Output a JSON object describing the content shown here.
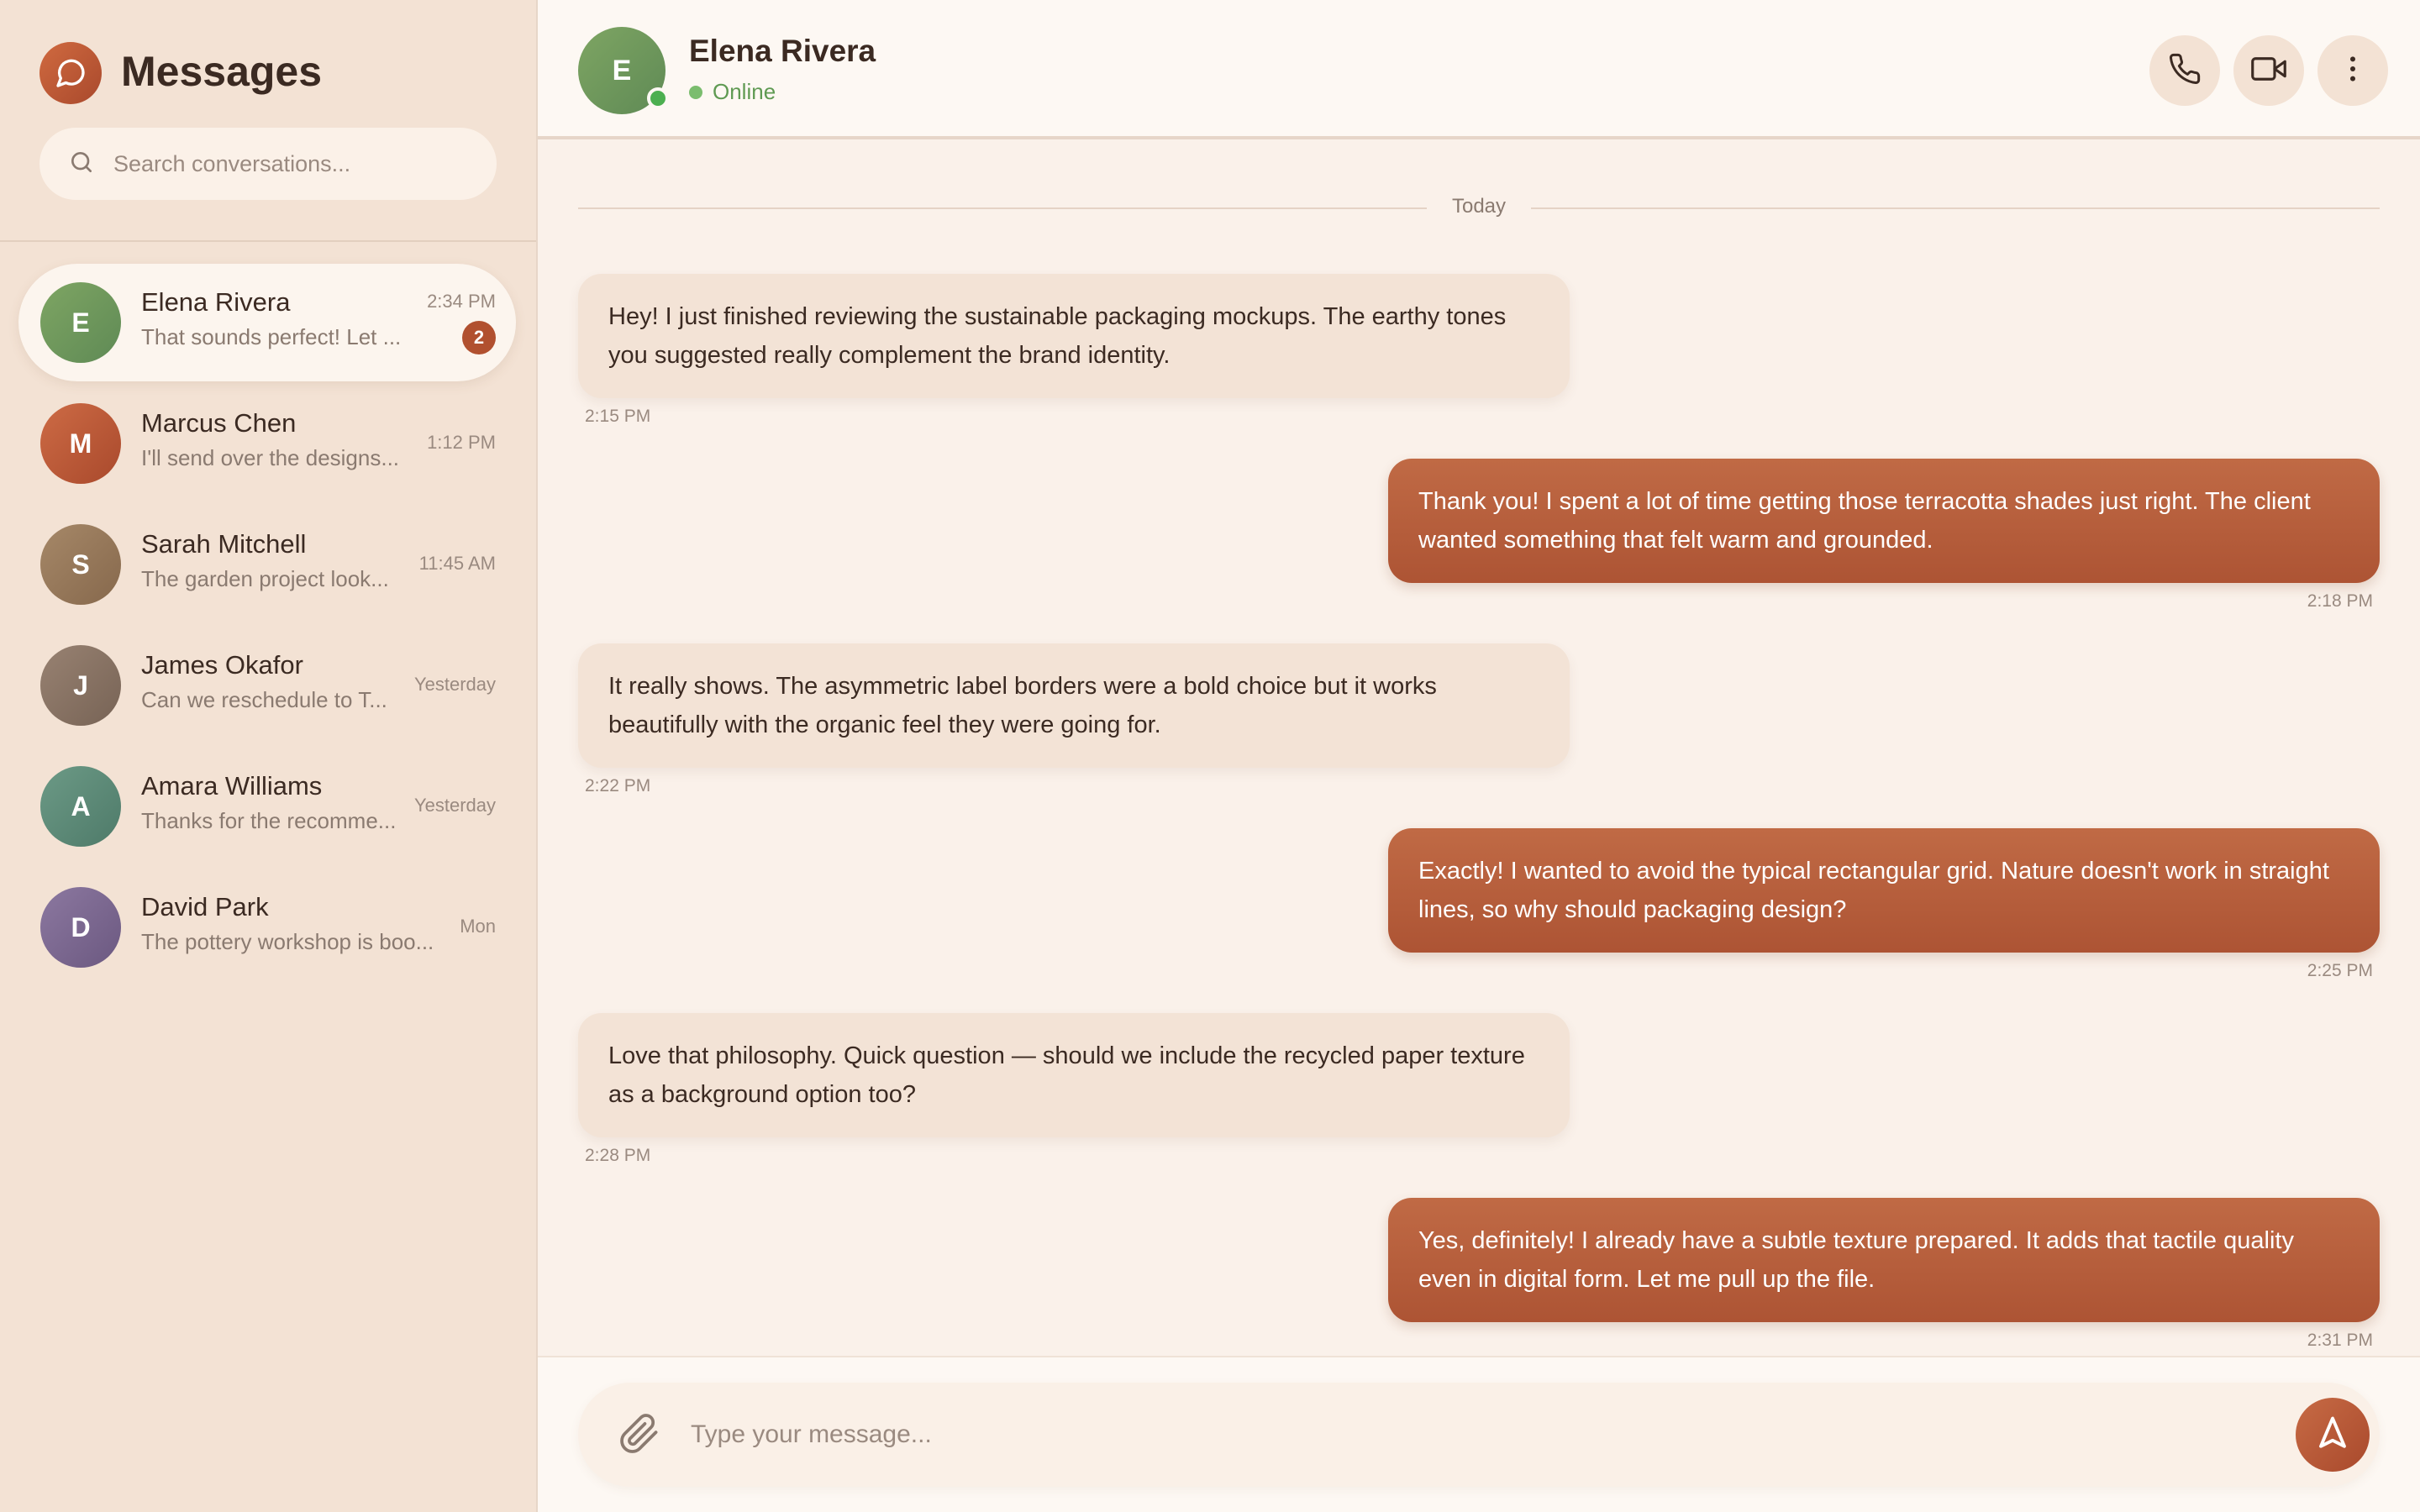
{
  "sidebar": {
    "title": "Messages",
    "search_placeholder": "Search conversations...",
    "conversations": [
      {
        "initial": "E",
        "name": "Elena Rivera",
        "preview": "That sounds perfect! Let ...",
        "time": "2:34 PM",
        "unread": "2",
        "color": "#6f9a5e"
      },
      {
        "initial": "M",
        "name": "Marcus Chen",
        "preview": "I'll send over the designs...",
        "time": "1:12 PM",
        "color": "#b8583a"
      },
      {
        "initial": "S",
        "name": "Sarah Mitchell",
        "preview": "The garden project look...",
        "time": "11:45 AM",
        "color": "#977a5c"
      },
      {
        "initial": "J",
        "name": "James Okafor",
        "preview": "Can we reschedule to T...",
        "time": "Yesterday",
        "color": "#8a7566"
      },
      {
        "initial": "A",
        "name": "Amara Williams",
        "preview": "Thanks for the recomme...",
        "time": "Yesterday",
        "color": "#5d8a78"
      },
      {
        "initial": "D",
        "name": "David Park",
        "preview": "The pottery workshop is boo...",
        "time": "Mon",
        "color": "#7e6a92"
      }
    ]
  },
  "chat": {
    "contact_initial": "E",
    "contact_name": "Elena Rivera",
    "status": "Online",
    "date_divider": "Today",
    "messages": [
      {
        "dir": "in",
        "text": "Hey! I just finished reviewing the sustainable packaging mockups. The earthy tones you suggested really complement the brand identity.",
        "time": "2:15 PM"
      },
      {
        "dir": "out",
        "text": "Thank you! I spent a lot of time getting those terracotta shades just right. The client wanted something that felt warm and grounded.",
        "time": "2:18 PM"
      },
      {
        "dir": "in",
        "text": "It really shows. The asymmetric label borders were a bold choice but it works beautifully with the organic feel they were going for.",
        "time": "2:22 PM"
      },
      {
        "dir": "out",
        "text": "Exactly! I wanted to avoid the typical rectangular grid. Nature doesn't work in straight lines, so why should packaging design?",
        "time": "2:25 PM"
      },
      {
        "dir": "in",
        "text": "Love that philosophy. Quick question — should we include the recycled paper texture as a background option too?",
        "time": "2:28 PM"
      },
      {
        "dir": "out",
        "text": "Yes, definitely! I already have a subtle texture prepared. It adds that tactile quality even in digital form. Let me pull up the file.",
        "time": "2:31 PM"
      }
    ],
    "composer_placeholder": "Type your message..."
  },
  "icons": {
    "logo": "chat-bubble-icon",
    "search": "search-icon",
    "call": "phone-icon",
    "video": "video-icon",
    "more": "more-vertical-icon",
    "attach": "paperclip-icon",
    "send": "send-icon"
  },
  "colors": {
    "accent": "#b1502f",
    "sidebar_bg": "#f3e2d4",
    "online": "#4caf50"
  }
}
